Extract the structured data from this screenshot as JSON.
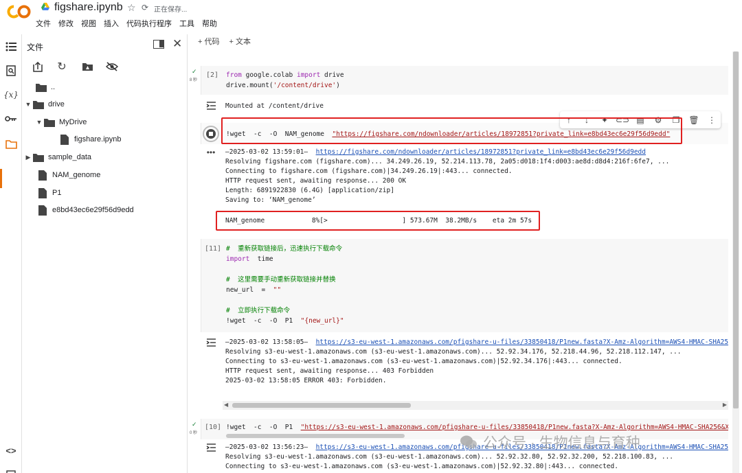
{
  "header": {
    "notebook_title": "figshare.ipynb",
    "save_status": "正在保存...",
    "menu": [
      "文件",
      "修改",
      "视图",
      "插入",
      "代码执行程序",
      "工具",
      "帮助"
    ]
  },
  "sidebar": {
    "title": "文件",
    "tree": [
      {
        "label": ".."
      },
      {
        "label": "drive"
      },
      {
        "label": "MyDrive"
      },
      {
        "label": "figshare.ipynb"
      },
      {
        "label": "sample_data"
      },
      {
        "label": "NAM_genome"
      },
      {
        "label": "P1"
      },
      {
        "label": "e8bd43ec6e29f56d9edd"
      }
    ]
  },
  "toolbar": {
    "add_code": "+ 代码",
    "add_text": "+ 文本"
  },
  "cells": {
    "c1": {
      "count": "[2]",
      "time": "8 秒",
      "l1_a": "from",
      "l1_b": " google.colab ",
      "l1_c": "import",
      "l1_d": " drive",
      "l2_a": "drive.mount(",
      "l2_b": "'/content/drive'",
      "l2_c": ")",
      "output": "Mounted at /content/drive"
    },
    "c2": {
      "cmd": "!wget  -c  -O  NAM_genome  ",
      "url": "\"https://figshare.com/ndownloader/articles/18972851?private_link=e8bd43ec6e29f56d9edd\"",
      "out_date": "—2025-03-02 13:59:01—  ",
      "out_url": "https://figshare.com/ndownloader/articles/18972851?private_link=e8bd43ec6e29f56d9edd",
      "out_lines": [
        "Resolving figshare.com (figshare.com)... 34.249.26.19, 52.214.113.78, 2a05:d018:1f4:d003:ae8d:d8d4:216f:6fe7, ...",
        "Connecting to figshare.com (figshare.com)|34.249.26.19|:443... connected.",
        "HTTP request sent, awaiting response... 200 OK",
        "Length: 6891922830 (6.4G) [application/zip]",
        "Saving to: ‘NAM_genome’"
      ],
      "progress": "NAM_genome            8%[>                   ] 573.67M  38.2MB/s    eta 2m 57s"
    },
    "c3": {
      "count": "[11]",
      "cmt1": "#  重新获取链接后，迅速执行下载命令",
      "imp_kw": "import",
      "imp_mod": "  time",
      "cmt2": "#  这里需要手动重新获取链接并替换",
      "var_a": "new_url  =  ",
      "var_b": "\"\"",
      "cmt3": "#  立即执行下载命令",
      "cmd_a": "!wget  -c  -O  P1  ",
      "cmd_b": "\"{new_url}\"",
      "out_date": "—2025-03-02 13:58:05—  ",
      "out_url": "https://s3-eu-west-1.amazonaws.com/pfigshare-u-files/33850418/P1new.fasta?X-Amz-Algorithm=AWS4-HMAC-SHA25",
      "out_lines": [
        "Resolving s3-eu-west-1.amazonaws.com (s3-eu-west-1.amazonaws.com)... 52.92.34.176, 52.218.44.96, 52.218.112.147, ...",
        "Connecting to s3-eu-west-1.amazonaws.com (s3-eu-west-1.amazonaws.com)|52.92.34.176|:443... connected.",
        "HTTP request sent, awaiting response... 403 Forbidden",
        "2025-03-02 13:58:05 ERROR 403: Forbidden."
      ]
    },
    "c4": {
      "count": "[10]",
      "time": "0 秒",
      "cmd": "!wget  -c  -O  P1  ",
      "url": "\"https://s3-eu-west-1.amazonaws.com/pfigshare-u-files/33850418/P1new.fasta?X-Amz-Algorithm=AWS4-HMAC-SHA256&X-",
      "out_date": "—2025-03-02 13:56:23—  ",
      "out_url": "https://s3-eu-west-1.amazonaws.com/pfigshare-u-files/33850418/P1new.fasta?X-Amz-Algorithm=AWS4-HMAC-SHA25",
      "out_lines": [
        "Resolving s3-eu-west-1.amazonaws.com (s3-eu-west-1.amazonaws.com)... 52.92.32.80, 52.92.32.200, 52.218.100.83, ...",
        "Connecting to s3-eu-west-1.amazonaws.com (s3-eu-west-1.amazonaws.com)|52.92.32.80|:443... connected."
      ]
    }
  },
  "watermark": {
    "text": "公众号 · 生物信息与育种"
  },
  "colors": {
    "accent_orange": "#e8710a",
    "highlight_red": "#e02020",
    "link_blue": "#1a4fb5",
    "keyword_purple": "#9c27b0",
    "comment_green": "#008000"
  }
}
